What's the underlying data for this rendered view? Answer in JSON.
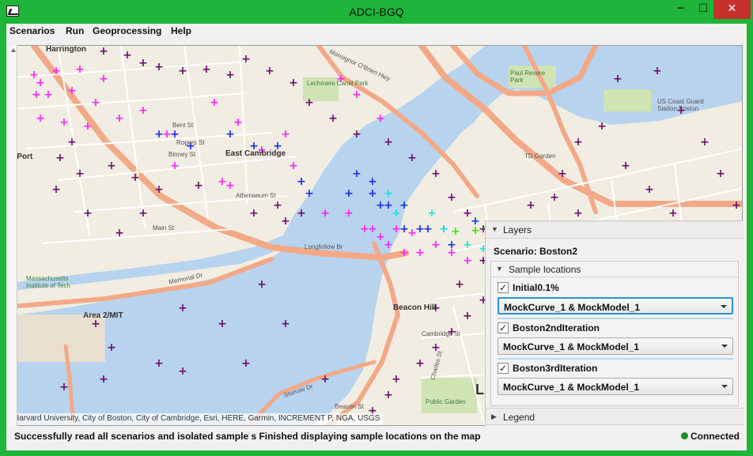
{
  "window": {
    "title": "ADCI-BGQ",
    "minimize_glyph": "─",
    "maximize_glyph": "☐",
    "close_glyph": "✕",
    "frame_color": "#1eb53a"
  },
  "menu": {
    "items": [
      {
        "label": "Scenarios"
      },
      {
        "label": "Run"
      },
      {
        "label": "Geoprocessing"
      },
      {
        "label": "Help"
      }
    ]
  },
  "map": {
    "attribution": "Harvard University, City of Boston, City of Cambridge, Esri, HERE, Garmin, INCREMENT P, NGA, USGS",
    "labels": [
      {
        "text": "Harrington",
        "cls": "big"
      },
      {
        "text": "East Cambridge",
        "cls": "big"
      },
      {
        "text": "Area 2/MIT",
        "cls": "big"
      },
      {
        "text": "Beacon Hill",
        "cls": "big"
      },
      {
        "text": "e Port",
        "cls": "big"
      },
      {
        "text": "Lechmere Canal Park",
        "cls": "green"
      },
      {
        "text": "Monsignor O'Brien Hwy",
        "cls": ""
      },
      {
        "text": "Bent St",
        "cls": ""
      },
      {
        "text": "Rogers St",
        "cls": ""
      },
      {
        "text": "Binney St",
        "cls": ""
      },
      {
        "text": "Athenaeum St",
        "cls": ""
      },
      {
        "text": "Main St",
        "cls": ""
      },
      {
        "text": "Longfellow Br",
        "cls": ""
      },
      {
        "text": "Memorial Dr",
        "cls": ""
      },
      {
        "text": "Storrow Dr",
        "cls": ""
      },
      {
        "text": "Beacon St",
        "cls": ""
      },
      {
        "text": "Massachusetts Institute of Tech",
        "cls": "green"
      },
      {
        "text": "TD Garden",
        "cls": ""
      },
      {
        "text": "Charles St",
        "cls": ""
      },
      {
        "text": "Cambridge St",
        "cls": ""
      },
      {
        "text": "Public Garden",
        "cls": "green"
      },
      {
        "text": "Paul Revere Park",
        "cls": "green"
      },
      {
        "text": "US Coast Guard Station Boston",
        "cls": ""
      },
      {
        "text": "Li",
        "cls": "big"
      }
    ],
    "marker_colors": {
      "initial": "#ff1fff",
      "second": "#6e0a6e",
      "third": "#1530e8",
      "cyan": "#19e3e3",
      "green": "#3ce01a"
    }
  },
  "layers_panel": {
    "title": "Layers",
    "scenario_label": "Scenario: Boston2",
    "sample_locations_title": "Sample locations",
    "layers": [
      {
        "name": "Initial0.1%",
        "checked": "✓",
        "model": "MockCurve_1 & MockModel_1"
      },
      {
        "name": "Boston2ndIteration",
        "checked": "✓",
        "model": "MockCurve_1 & MockModel_1"
      },
      {
        "name": "Boston3rdIteration",
        "checked": "✓",
        "model": "MockCurve_1 & MockModel_1"
      }
    ],
    "legend_title": "Legend"
  },
  "status": {
    "message": "Successfully read all scenarios and isolated sample s Finished displaying sample locations on the map",
    "connection": "Connected",
    "connection_color": "#1f8f2a"
  }
}
